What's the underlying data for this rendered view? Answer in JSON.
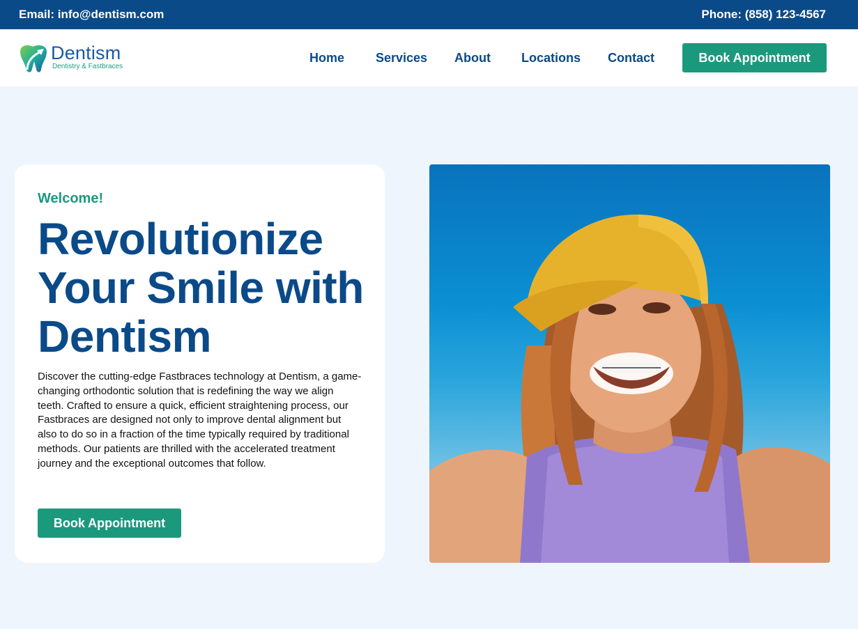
{
  "topbar": {
    "email": "Email: info@dentism.com",
    "phone": "Phone: (858) 123-4567"
  },
  "brand": {
    "name": "Dentism",
    "tagline": "Dentistry & Fastbraces",
    "logo_icon": "tooth-logo-icon",
    "colors": {
      "primary": "#0b4a88",
      "accent": "#1b997c",
      "background": "#eef5fd"
    }
  },
  "nav": {
    "items": [
      "Home",
      "Services",
      "About",
      "Locations",
      "Contact"
    ],
    "cta": "Book Appointment"
  },
  "hero": {
    "welcome": "Welcome!",
    "title": "Revolutionize Your Smile with Dentism",
    "body": "Discover the cutting-edge Fastbraces technology at Dentism, a game-changing orthodontic solution that is redefining the way we align teeth. Crafted to ensure a quick, efficient straightening process, our Fastbraces are designed not only to improve dental alignment but also to do so in a fraction of the time typically required by traditional methods. Our patients are thrilled with the accelerated treatment journey and the exceptional outcomes that follow.",
    "cta": "Book Appointment"
  }
}
